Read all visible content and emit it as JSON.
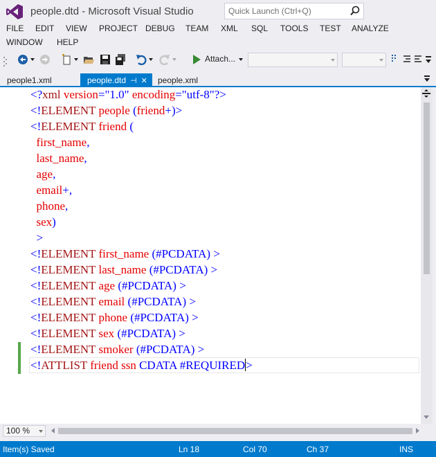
{
  "window": {
    "title": "people.dtd - Microsoft Visual Studio",
    "quick_launch_placeholder": "Quick Launch (Ctrl+Q)"
  },
  "menu": [
    "FILE",
    "EDIT",
    "VIEW",
    "PROJECT",
    "DEBUG",
    "TEAM",
    "XML",
    "SQL",
    "TOOLS",
    "TEST",
    "ANALYZE",
    "WINDOW",
    "HELP"
  ],
  "toolbar": {
    "attach_label": "Attach...",
    "icons": [
      "back-icon",
      "forward-icon",
      "new-project-icon",
      "open-file-icon",
      "save-icon",
      "save-all-icon",
      "undo-icon",
      "redo-icon",
      "start-debug-icon"
    ]
  },
  "tabs": [
    {
      "label": "people1.xml",
      "active": false
    },
    {
      "label": "people.dtd",
      "active": true
    },
    {
      "label": "people.xml",
      "active": false
    }
  ],
  "editor": {
    "lines": [
      [
        [
          "<?",
          "b"
        ],
        [
          "xml",
          "r"
        ],
        [
          " ",
          ""
        ],
        [
          "version",
          "rd"
        ],
        [
          "=\"",
          "b"
        ],
        [
          "1.0",
          "b"
        ],
        [
          "\" ",
          "b"
        ],
        [
          "encoding",
          "rd"
        ],
        [
          "=\"",
          "b"
        ],
        [
          "utf-8",
          "b"
        ],
        [
          "\"?>",
          "b"
        ]
      ],
      [
        [
          "<!",
          "b"
        ],
        [
          "ELEMENT",
          "r"
        ],
        [
          " people ",
          "rd"
        ],
        [
          "(",
          "b"
        ],
        [
          "friend",
          "rd"
        ],
        [
          "+)>",
          "b"
        ]
      ],
      [
        [
          "<!",
          "b"
        ],
        [
          "ELEMENT",
          "r"
        ],
        [
          " friend ",
          "rd"
        ],
        [
          "(",
          "b"
        ]
      ],
      [
        [
          "  first_name",
          "rd"
        ],
        [
          ",",
          "b"
        ]
      ],
      [
        [
          "  last_name",
          "rd"
        ],
        [
          ",",
          "b"
        ]
      ],
      [
        [
          "  age",
          "rd"
        ],
        [
          ",",
          "b"
        ]
      ],
      [
        [
          "  email",
          "rd"
        ],
        [
          "+,",
          "b"
        ]
      ],
      [
        [
          "  phone",
          "rd"
        ],
        [
          ",",
          "b"
        ]
      ],
      [
        [
          "  sex",
          "rd"
        ],
        [
          ")",
          "b"
        ]
      ],
      [
        [
          "  >",
          "b"
        ]
      ],
      [
        [
          "<!",
          "b"
        ],
        [
          "ELEMENT",
          "r"
        ],
        [
          " first_name ",
          "rd"
        ],
        [
          "(#PCDATA) >",
          "b"
        ]
      ],
      [
        [
          "<!",
          "b"
        ],
        [
          "ELEMENT",
          "r"
        ],
        [
          " last_name ",
          "rd"
        ],
        [
          "(#PCDATA) >",
          "b"
        ]
      ],
      [
        [
          "<!",
          "b"
        ],
        [
          "ELEMENT",
          "r"
        ],
        [
          " age ",
          "rd"
        ],
        [
          "(#PCDATA) >",
          "b"
        ]
      ],
      [
        [
          "<!",
          "b"
        ],
        [
          "ELEMENT",
          "r"
        ],
        [
          " email ",
          "rd"
        ],
        [
          "(#PCDATA) >",
          "b"
        ]
      ],
      [
        [
          "<!",
          "b"
        ],
        [
          "ELEMENT",
          "r"
        ],
        [
          " phone ",
          "rd"
        ],
        [
          "(#PCDATA) >",
          "b"
        ]
      ],
      [
        [
          "<!",
          "b"
        ],
        [
          "ELEMENT",
          "r"
        ],
        [
          " sex ",
          "rd"
        ],
        [
          "(#PCDATA) >",
          "b"
        ]
      ],
      [
        [
          "<!",
          "b"
        ],
        [
          "ELEMENT",
          "r"
        ],
        [
          " smoker ",
          "rd"
        ],
        [
          "(#PCDATA) >",
          "b"
        ]
      ],
      [
        [
          "<!",
          "b"
        ],
        [
          "ATTLIST",
          "r"
        ],
        [
          " friend ssn ",
          "rd"
        ],
        [
          "CDATA #REQUIRED",
          "b"
        ],
        [
          "|",
          "caret"
        ],
        [
          ">",
          "b"
        ]
      ]
    ]
  },
  "zoom": "100 %",
  "status": {
    "message": "Item(s) Saved",
    "line": "Ln 18",
    "col": "Col 70",
    "ch": "Ch 37",
    "mode": "INS"
  },
  "colors": {
    "accent": "#007acc",
    "keyword_blue": "#0000ff",
    "element_red": "#a31515",
    "name_red": "#e50000",
    "change_green": "#57a64a"
  }
}
